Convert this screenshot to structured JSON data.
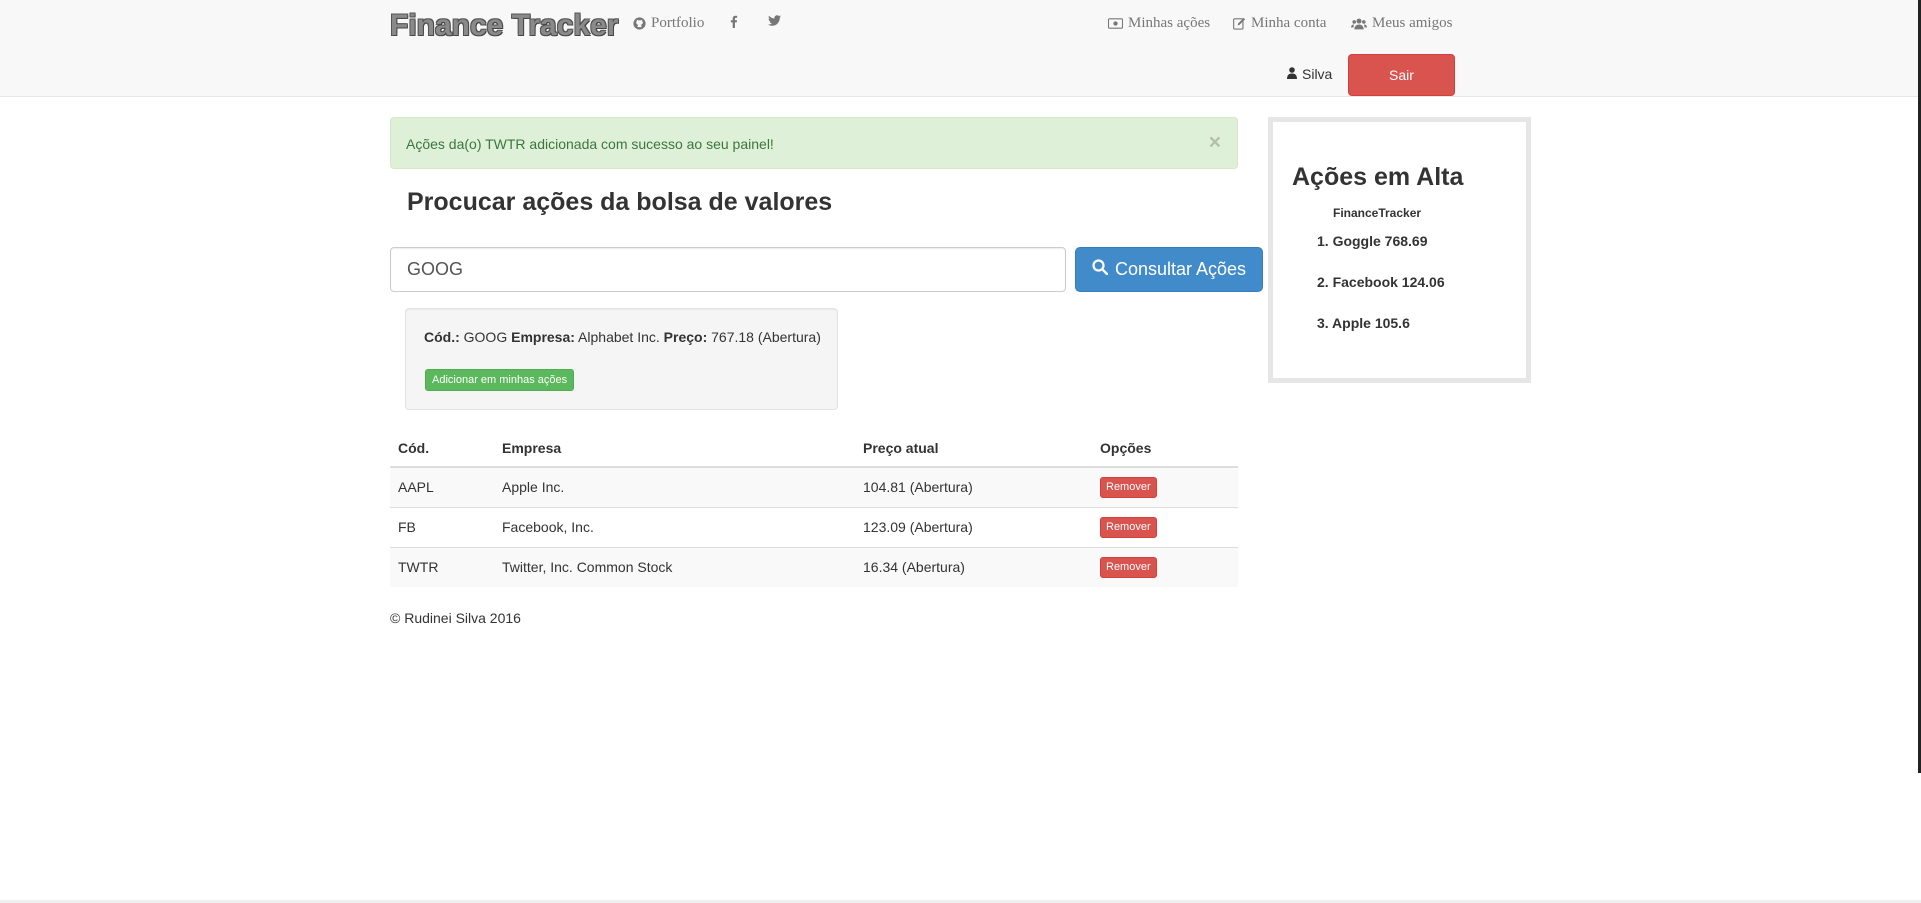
{
  "navbar": {
    "brand": "Finance Tracker",
    "links_left": [
      {
        "label": "Portfolio",
        "icon": "github-icon"
      },
      {
        "label": "",
        "icon": "facebook-icon"
      },
      {
        "label": "",
        "icon": "twitter-icon"
      }
    ],
    "links_right": [
      {
        "label": "Minhas ações",
        "icon": "money-icon"
      },
      {
        "label": "Minha conta",
        "icon": "edit-icon"
      },
      {
        "label": "Meus amigos",
        "icon": "users-icon"
      }
    ],
    "user_name": "Silva",
    "logout_label": "Sair"
  },
  "alert": {
    "message": "Ações da(o) TWTR adicionada com sucesso ao seu painel!",
    "close": "×"
  },
  "search": {
    "title": "Procucar ações da bolsa de valores",
    "value": "GOOG",
    "button_label": "Consultar Ações"
  },
  "result": {
    "code_label": "Cód.:",
    "code": "GOOG",
    "company_label": "Empresa:",
    "company": "Alphabet Inc.",
    "price_label": "Preço:",
    "price": "767.18 (Abertura)",
    "add_label": "Adicionar em minhas ações"
  },
  "table": {
    "headers": [
      "Cód.",
      "Empresa",
      "Preço atual",
      "Opções"
    ],
    "rows": [
      {
        "code": "AAPL",
        "company": "Apple Inc.",
        "price": "104.81 (Abertura)",
        "action": "Remover"
      },
      {
        "code": "FB",
        "company": "Facebook, Inc.",
        "price": "123.09 (Abertura)",
        "action": "Remover"
      },
      {
        "code": "TWTR",
        "company": "Twitter, Inc. Common Stock",
        "price": "16.34 (Abertura)",
        "action": "Remover"
      }
    ]
  },
  "footer": "© Rudinei Silva 2016",
  "sidebar": {
    "title": "Ações em Alta",
    "subtitle": "FinanceTracker",
    "items": [
      "1. Goggle 768.69",
      "2. Facebook 124.06",
      "3. Apple 105.6"
    ]
  },
  "colors": {
    "primary": "#428bca",
    "danger": "#d9534f",
    "success": "#5cb85c",
    "alert_bg": "#dff0d8",
    "alert_text": "#3c763d"
  }
}
